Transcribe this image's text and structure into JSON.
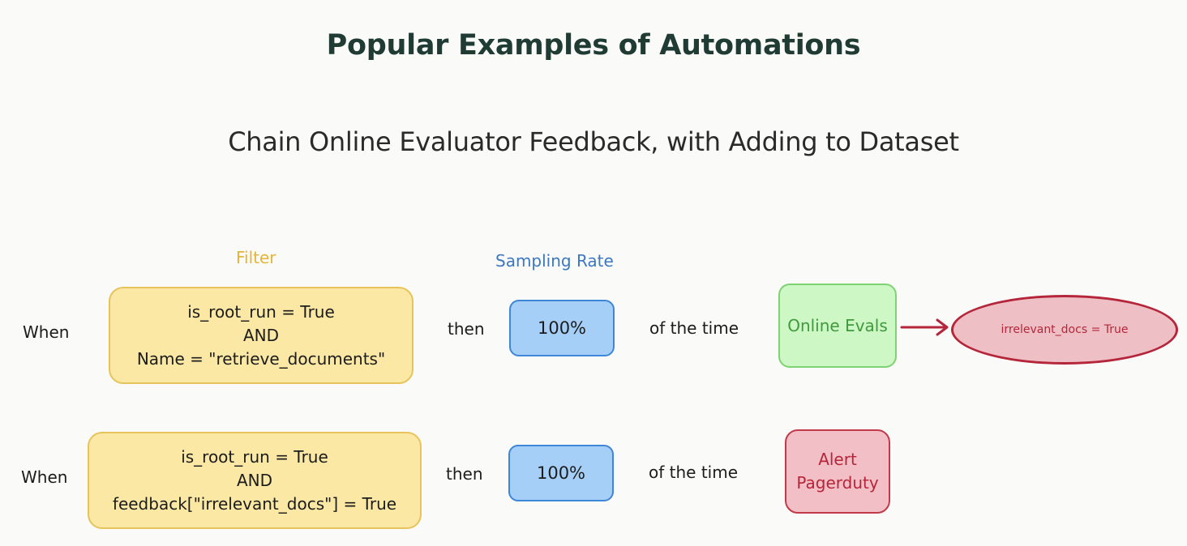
{
  "title": "Popular Examples of Automations",
  "subtitle": "Chain Online Evaluator Feedback, with Adding to Dataset",
  "columns": {
    "filter": "Filter",
    "sampling_rate": "Sampling Rate"
  },
  "rows": [
    {
      "when": "When",
      "filter_lines": [
        "is_root_run = True",
        "AND",
        "Name = \"retrieve_documents\""
      ],
      "then": "then",
      "rate": "100%",
      "of_the_time": "of the time",
      "action_lines": [
        "Online Evals"
      ],
      "result": "irrelevant_docs = True"
    },
    {
      "when": "When",
      "filter_lines": [
        "is_root_run = True",
        "AND",
        "feedback[\"irrelevant_docs\"] = True"
      ],
      "then": "then",
      "rate": "100%",
      "of_the_time": "of the time",
      "action_lines": [
        "Alert",
        "Pagerduty"
      ]
    }
  ],
  "colors": {
    "filter_label": "#e4b43a",
    "sampling_label": "#3b78c0",
    "filter_fill": "#fbe8a4",
    "rate_fill": "#a6cff7",
    "evals_fill": "#cdf7c4",
    "alert_fill": "#f3bfc6",
    "result_stroke": "#b5263a"
  }
}
